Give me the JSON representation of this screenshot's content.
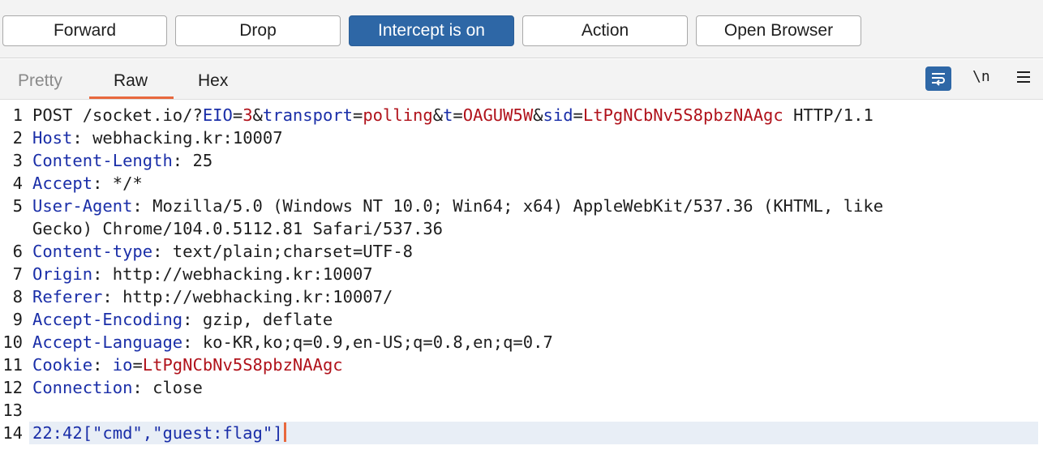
{
  "toolbar": {
    "forward_label": "Forward",
    "drop_label": "Drop",
    "intercept_label": "Intercept is on",
    "action_label": "Action",
    "open_browser_label": "Open Browser",
    "accent_color": "#2e67a6"
  },
  "tabs": {
    "pretty": "Pretty",
    "raw": "Raw",
    "hex": "Hex",
    "active": "Raw",
    "newline_icon_text": "\\n",
    "icons": [
      "wrap-text-icon",
      "newline-icon",
      "menu-icon"
    ]
  },
  "request": {
    "line_numbers": [
      "1",
      "2",
      "3",
      "4",
      "5",
      "",
      "6",
      "7",
      "8",
      "9",
      "10",
      "11",
      "12",
      "13",
      "14"
    ],
    "request_line": {
      "method_path": "POST /socket.io/?",
      "params": [
        {
          "name": "EIO",
          "value": "3"
        },
        {
          "name": "transport",
          "value": "polling"
        },
        {
          "name": "t",
          "value": "OAGUW5W"
        },
        {
          "name": "sid",
          "value": "LtPgNCbNv5S8pbzNAAgc"
        }
      ],
      "version": " HTTP/1.1"
    },
    "headers": [
      {
        "name": "Host",
        "value": "webhacking.kr:10007"
      },
      {
        "name": "Content-Length",
        "value": "25"
      },
      {
        "name": "Accept",
        "value": "*/*"
      },
      {
        "name": "User-Agent",
        "value": "Mozilla/5.0 (Windows NT 10.0; Win64; x64) AppleWebKit/537.36 (KHTML, like",
        "continuation": "Gecko) Chrome/104.0.5112.81 Safari/537.36"
      },
      {
        "name": "Content-type",
        "value": "text/plain;charset=UTF-8"
      },
      {
        "name": "Origin",
        "value": "http://webhacking.kr:10007"
      },
      {
        "name": "Referer",
        "value": "http://webhacking.kr:10007/"
      },
      {
        "name": "Accept-Encoding",
        "value": "gzip, deflate"
      },
      {
        "name": "Accept-Language",
        "value": "ko-KR,ko;q=0.9,en-US;q=0.8,en;q=0.7"
      },
      {
        "name": "Cookie",
        "cookie_name": "io",
        "cookie_value": "LtPgNCbNv5S8pbzNAAgc"
      },
      {
        "name": "Connection",
        "value": "close"
      }
    ],
    "body": "22:42[\"cmd\",\"guest:flag\"]"
  }
}
